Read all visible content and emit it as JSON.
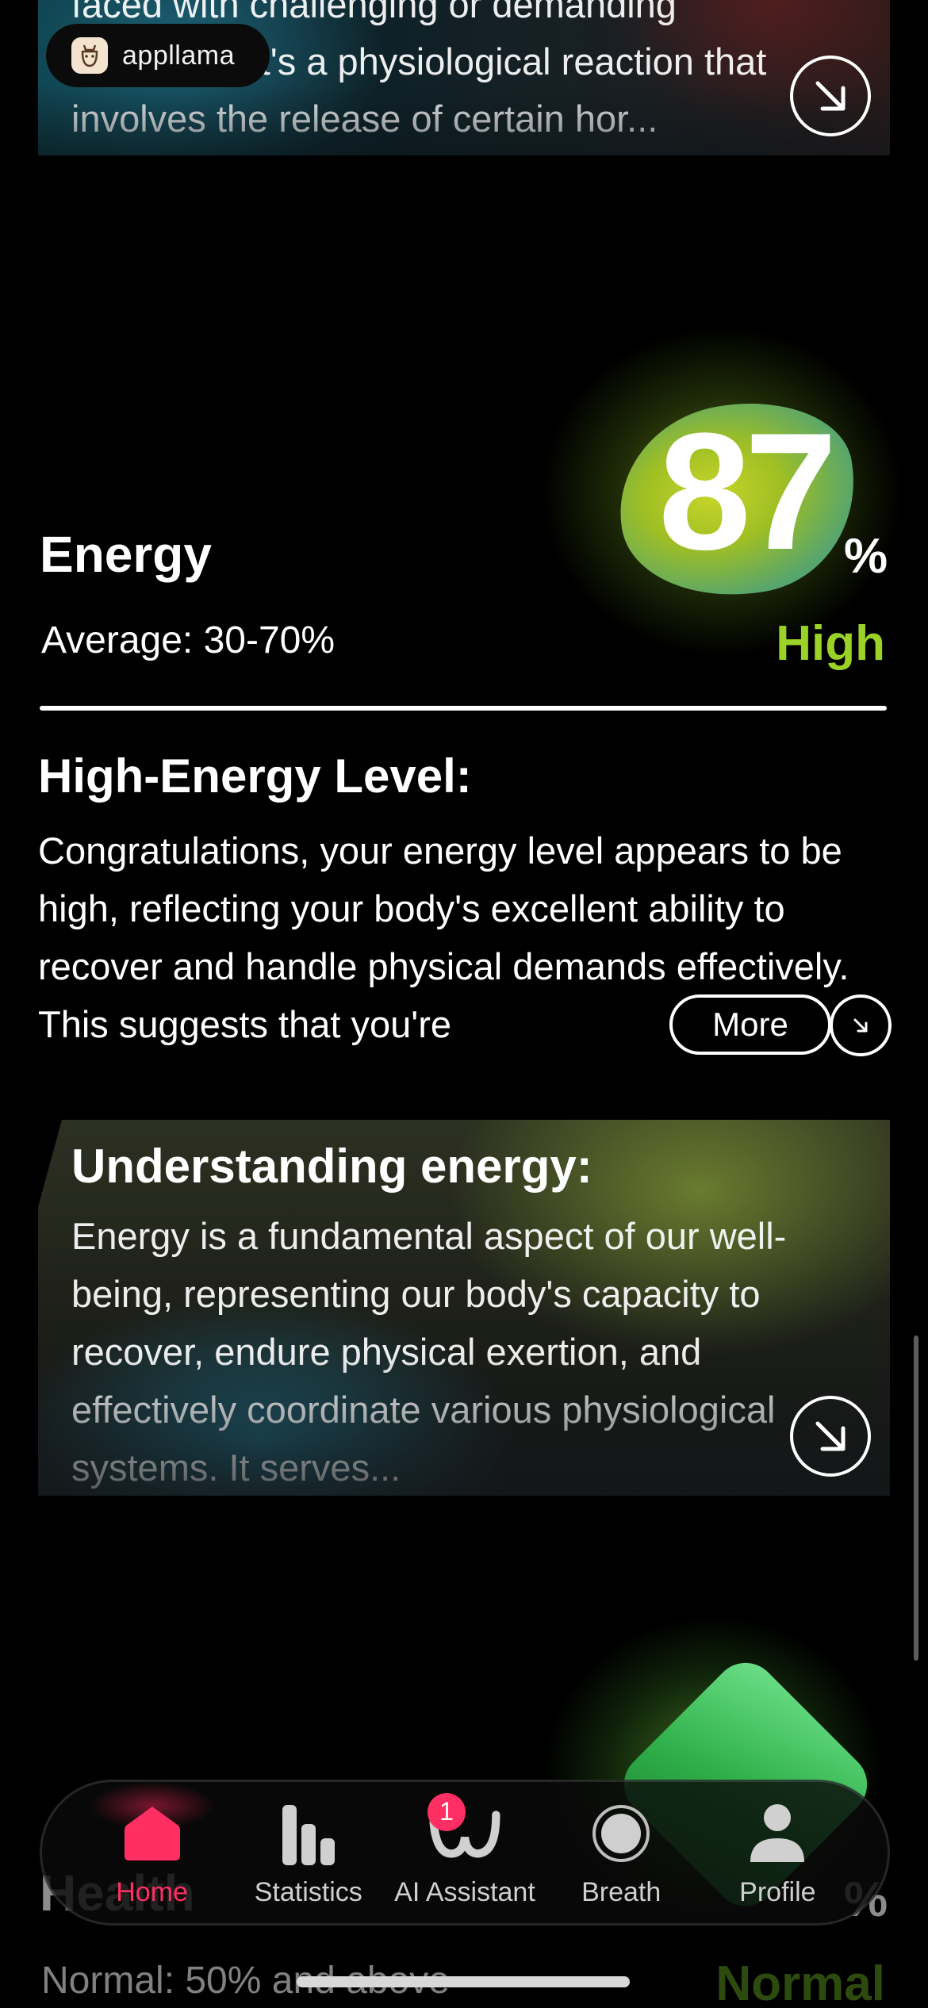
{
  "top_card": {
    "text": "faced with challenging or demanding situations. It's a physiological reaction that involves the release of certain hor..."
  },
  "brand": {
    "name": "appllama"
  },
  "energy": {
    "title": "Energy",
    "value": "87",
    "unit": "%",
    "average_label": "Average: 30-70%",
    "level": "High",
    "level_color": "#9ad227"
  },
  "high_energy": {
    "title": "High-Energy Level:",
    "text": " Congratulations, your energy level appears to be high, reflecting your body's excellent ability to recover and handle physical demands effectively. This suggests that you're",
    "more_label": "More"
  },
  "understanding": {
    "title": "Understanding energy:",
    "text": "Energy is a fundamental aspect of our well-being, representing our body's capacity to recover, endure physical exertion, and effectively coordinate various physiological systems. It serves..."
  },
  "next_section": {
    "title": "Health",
    "unit": "%",
    "average_label": "Normal: 50% and above",
    "level": "Normal"
  },
  "tabbar": {
    "tabs": [
      {
        "label": "Home",
        "icon": "home-icon",
        "active": true
      },
      {
        "label": "Statistics",
        "icon": "statistics-icon"
      },
      {
        "label": "AI Assistant",
        "icon": "ai-assistant-icon",
        "badge": "1"
      },
      {
        "label": "Breath",
        "icon": "breath-icon"
      },
      {
        "label": "Profile",
        "icon": "profile-icon"
      }
    ]
  },
  "colors": {
    "accent": "#ff2e63",
    "energy_high": "#9ad227"
  }
}
